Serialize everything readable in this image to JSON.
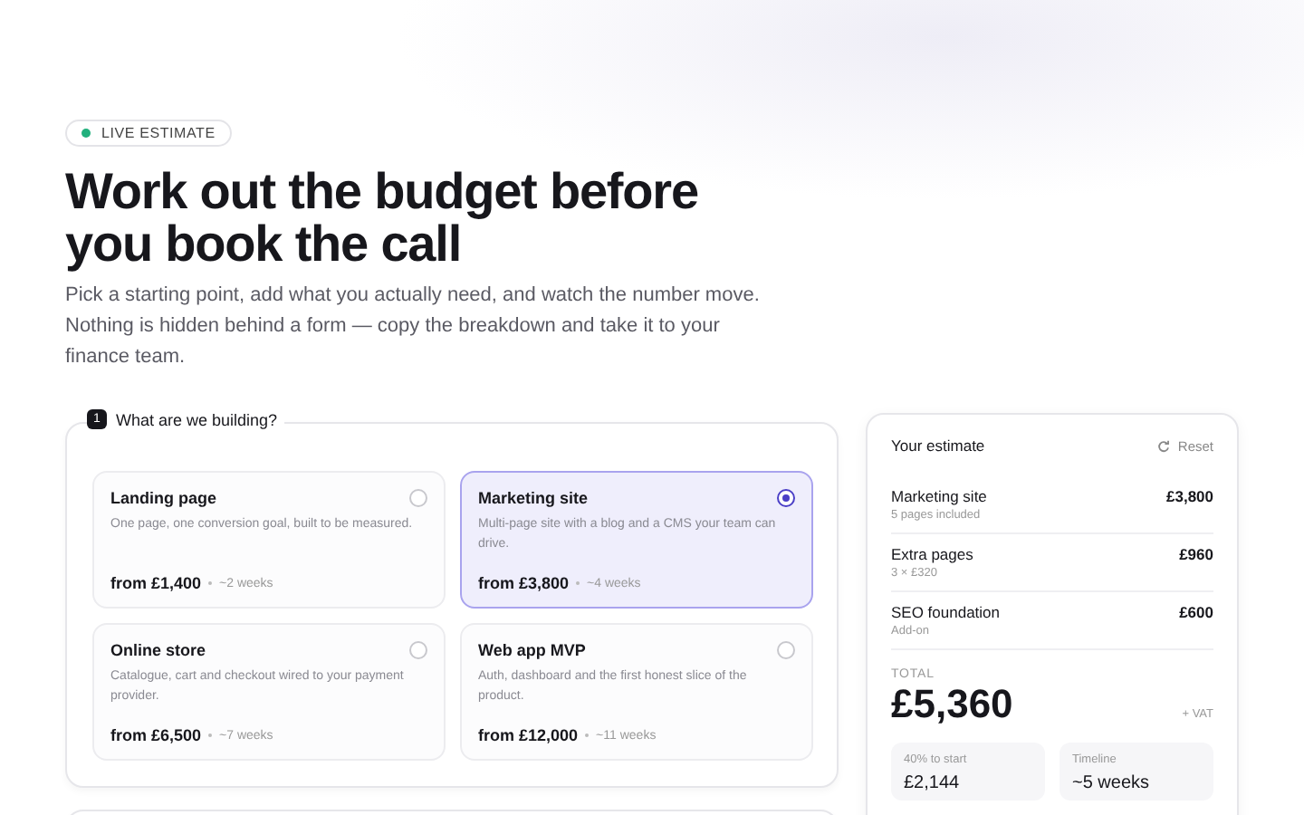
{
  "badge": {
    "label": "LIVE ESTIMATE"
  },
  "hero": {
    "title": "Work out the budget before you book the call",
    "lead": "Pick a starting point, add what you actually need, and watch the number move. Nothing is hidden behind a form — copy the breakdown and take it to your finance team."
  },
  "step": {
    "number": "1",
    "title": "What are we building?",
    "options": [
      {
        "name": "Landing page",
        "description": "One page, one conversion goal, built to be measured.",
        "price": "from £1,400",
        "duration": "~2 weeks",
        "selected": false
      },
      {
        "name": "Marketing site",
        "description": "Multi-page site with a blog and a CMS your team can drive.",
        "price": "from £3,800",
        "duration": "~4 weeks",
        "selected": true
      },
      {
        "name": "Online store",
        "description": "Catalogue, cart and checkout wired to your payment provider.",
        "price": "from £6,500",
        "duration": "~7 weeks",
        "selected": false
      },
      {
        "name": "Web app MVP",
        "description": "Auth, dashboard and the first honest slice of the product.",
        "price": "from £12,000",
        "duration": "~11 weeks",
        "selected": false
      }
    ]
  },
  "estimate": {
    "title": "Your estimate",
    "reset": "Reset",
    "lines": [
      {
        "label": "Marketing site",
        "note": "5 pages included",
        "amount": "£3,800"
      },
      {
        "label": "Extra pages",
        "note": "3 × £320",
        "amount": "£960"
      },
      {
        "label": "SEO foundation",
        "note": "Add-on",
        "amount": "£600"
      }
    ],
    "total_label": "TOTAL",
    "total": "£5,360",
    "vat": "+ VAT",
    "stats": [
      {
        "label": "40% to start",
        "value": "£2,144"
      },
      {
        "label": "Timeline",
        "value": "~5 weeks"
      }
    ]
  }
}
